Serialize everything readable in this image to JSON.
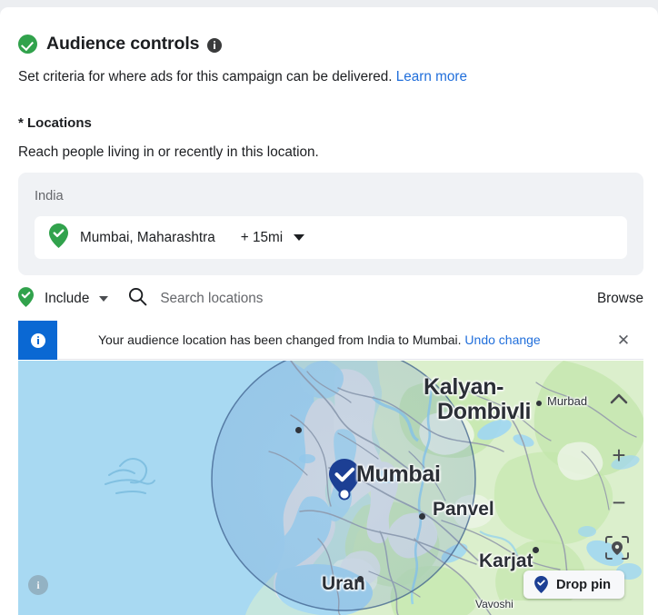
{
  "header": {
    "title": "Audience controls",
    "status_icon": "green-check-badge",
    "info_icon": "info-icon",
    "subtitle": "Set criteria for where ads for this campaign can be delivered.",
    "learn_more": "Learn more"
  },
  "locations": {
    "label": "* Locations",
    "description": "Reach people living in or recently in this location.",
    "country": "India",
    "chip": {
      "pin_icon": "green-location-pin-icon",
      "name": "Mumbai, Maharashtra",
      "radius": "+ 15mi",
      "caret_icon": "chevron-down-icon"
    },
    "include": {
      "pin_icon": "green-location-pin-icon",
      "label": "Include",
      "caret_icon": "chevron-down-icon"
    },
    "search": {
      "icon": "search-icon",
      "placeholder": "Search locations"
    },
    "browse": "Browse"
  },
  "banner": {
    "icon": "info-icon",
    "message": "Your audience location has been changed from India to Mumbai.",
    "undo_label": "Undo change",
    "close_icon": "close-icon",
    "accent_color": "#0a68d3"
  },
  "map": {
    "marker": {
      "icon": "selected-location-pin-icon",
      "label": "Mumbai"
    },
    "labels": [
      {
        "name": "Kalyan-",
        "size": "big"
      },
      {
        "name": "Dombivli",
        "size": "big"
      },
      {
        "name": "Murbad",
        "size": "sm"
      },
      {
        "name": "Panvel",
        "size": "mid"
      },
      {
        "name": "Karjat",
        "size": "mid"
      },
      {
        "name": "Uran",
        "size": "mid"
      },
      {
        "name": "Vavoshi",
        "size": "xs"
      }
    ],
    "controls": {
      "collapse_icon": "chevron-up-icon",
      "zoom_in": "+",
      "zoom_out": "−",
      "locate_icon": "recenter-location-icon",
      "info_icon": "map-info-icon"
    },
    "drop_pin": {
      "icon": "blue-location-pin-icon",
      "label": "Drop pin"
    }
  },
  "colors": {
    "green": "#31a24c",
    "blue_link": "#216fdb",
    "banner_blue": "#0a68d3",
    "pin_navy": "#1c3f94",
    "panel_grey": "#f0f2f5",
    "map_water": "#a8d8f0",
    "map_land": "#d8edc8"
  }
}
